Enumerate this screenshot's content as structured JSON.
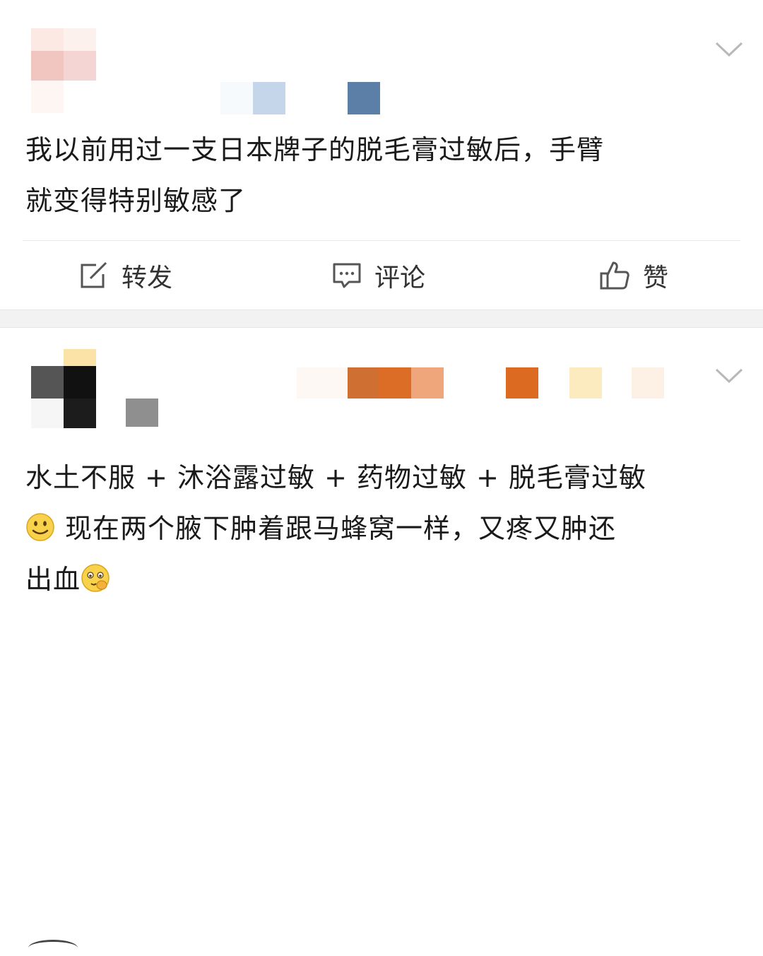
{
  "post1": {
    "text_line1": "我以前用过一支日本牌子的脱毛膏过敏后，手臂",
    "text_line2": "就变得特别敏感了",
    "actions": {
      "repost_label": "转发",
      "comment_label": "评论",
      "like_label": "赞"
    },
    "icons": {
      "repost": "repost-icon",
      "comment": "comment-icon",
      "like": "thumbs-up-icon",
      "more": "chevron-down-icon"
    }
  },
  "post2": {
    "text_line1": "水土不服 + 沐浴露过敏 + 药物过敏 + 脱毛膏过敏",
    "text_line2": "现在两个腋下肿着跟马蜂窝一样，又疼又肿还",
    "text_line3": "出血",
    "icons": {
      "smile": "smile-emoji-icon",
      "shy": "shy-emoji-icon",
      "more": "chevron-down-icon"
    }
  },
  "colors": {
    "separator": "#f2f2f2",
    "text": "#1a1a1a",
    "action_text": "#333333",
    "icon": "#555555"
  }
}
